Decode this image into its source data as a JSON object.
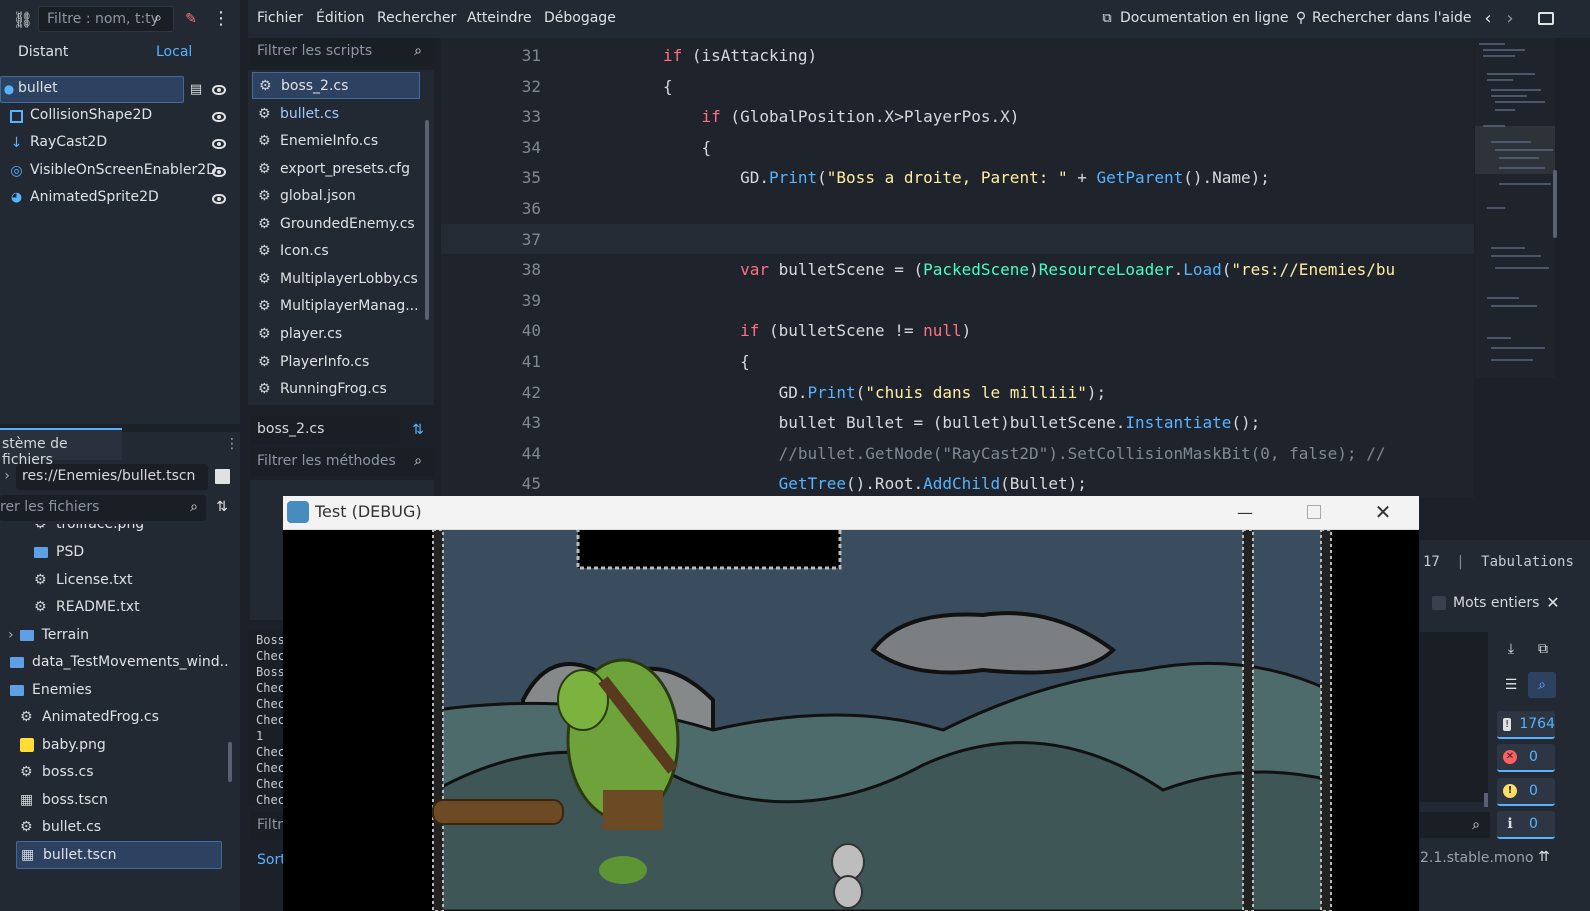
{
  "scene": {
    "filter_placeholder": "Filtre : nom, t:ty",
    "tabs": [
      "Distant",
      "Local"
    ],
    "nodes": [
      {
        "label": "bullet",
        "icon": "circle-node-icon"
      },
      {
        "label": "CollisionShape2D",
        "icon": "collision-shape-icon"
      },
      {
        "label": "RayCast2D",
        "icon": "raycast-icon"
      },
      {
        "label": "VisibleOnScreenEnabler2D",
        "icon": "visibility-enabler-icon"
      },
      {
        "label": "AnimatedSprite2D",
        "icon": "animated-sprite-icon"
      }
    ]
  },
  "filesystem": {
    "title": "stème de fichiers",
    "path": "res://Enemies/bullet.tscn",
    "filter_placeholder": "rer les fichiers",
    "items": [
      {
        "label": "trollface.png",
        "type": "image"
      },
      {
        "label": "PSD",
        "type": "folder"
      },
      {
        "label": "License.txt",
        "type": "file"
      },
      {
        "label": "README.txt",
        "type": "file"
      },
      {
        "label": "Terrain",
        "type": "folder"
      },
      {
        "label": "data_TestMovements_wind...",
        "type": "folder"
      },
      {
        "label": "Enemies",
        "type": "folder"
      },
      {
        "label": "AnimatedFrog.cs",
        "type": "script"
      },
      {
        "label": "baby.png",
        "type": "image"
      },
      {
        "label": "boss.cs",
        "type": "script"
      },
      {
        "label": "boss.tscn",
        "type": "scene"
      },
      {
        "label": "bullet.cs",
        "type": "script"
      },
      {
        "label": "bullet.tscn",
        "type": "scene"
      }
    ]
  },
  "menu": {
    "items": [
      "Fichier",
      "Édition",
      "Rechercher",
      "Atteindre",
      "Débogage"
    ],
    "doc_link": "Documentation en ligne",
    "search_help": "Rechercher dans l'aide"
  },
  "scripts": {
    "filter_placeholder": "Filtrer les scripts",
    "items": [
      "boss_2.cs",
      "bullet.cs",
      "EnemieInfo.cs",
      "export_presets.cfg",
      "global.json",
      "GroundedEnemy.cs",
      "Icon.cs",
      "MultiplayerLobby.cs",
      "MultiplayerManag...",
      "player.cs",
      "PlayerInfo.cs",
      "RunningFrog.cs"
    ],
    "current": "boss_2.cs",
    "methods_placeholder": "Filtrer les méthodes",
    "filter_short": "Filtr",
    "sort_short": "Sort"
  },
  "output_lines": [
    "Boss",
    "Chec",
    "Boss",
    "Chec",
    "Chec",
    "Chec",
    "1",
    "Chec",
    "Chec",
    "Chec",
    "Chec"
  ],
  "code": {
    "lines": [
      {
        "n": "31",
        "t": "if (isAttacking)"
      },
      {
        "n": "32",
        "t": "{"
      },
      {
        "n": "33",
        "t": "    if (GlobalPosition.X>PlayerPos.X)"
      },
      {
        "n": "34",
        "t": "    {"
      },
      {
        "n": "35",
        "t": "        GD.Print(\"Boss a droite, Parent: \" + GetParent().Name);"
      },
      {
        "n": "36",
        "t": ""
      },
      {
        "n": "37",
        "t": ""
      },
      {
        "n": "38",
        "t": "        var bulletScene = (PackedScene)ResourceLoader.Load(\"res://Enemies/bu"
      },
      {
        "n": "39",
        "t": ""
      },
      {
        "n": "40",
        "t": "        if (bulletScene != null)"
      },
      {
        "n": "41",
        "t": "        {"
      },
      {
        "n": "42",
        "t": "            GD.Print(\"chuis dans le milliii\");"
      },
      {
        "n": "43",
        "t": "            bullet Bullet = (bullet)bulletScene.Instantiate();"
      },
      {
        "n": "44",
        "t": "            //bullet.GetNode(\"RayCast2D\").SetCollisionMaskBit(0, false); //"
      },
      {
        "n": "45",
        "t": "            GetTree().Root.AddChild(Bullet);"
      }
    ]
  },
  "status": {
    "col": "17",
    "indent": "Tabulations",
    "whole_words": "Mots entiers",
    "version": "2.1.stable.mono"
  },
  "debug_window": {
    "title": "Test (DEBUG)"
  },
  "counters": {
    "messages": "1764",
    "errors": "0",
    "warnings": "0",
    "info": "0"
  },
  "colors": {
    "accent": "#57b3ff",
    "error": "#ff5f5f",
    "warning": "#ffdd65",
    "bg": "#1c2129"
  }
}
